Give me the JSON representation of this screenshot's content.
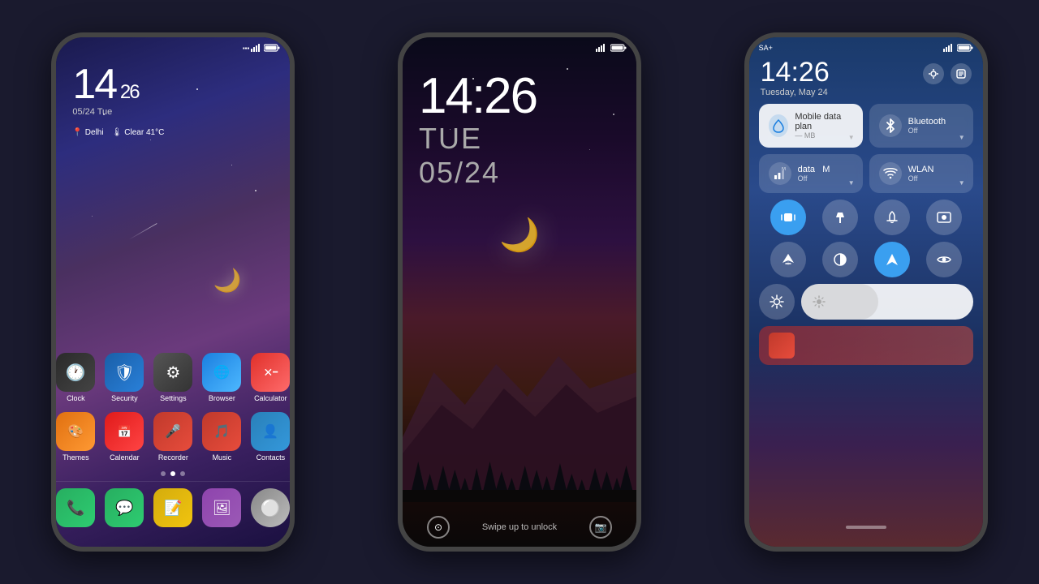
{
  "phones": [
    {
      "id": "phone1",
      "type": "home",
      "status": {
        "time": "14:26",
        "signal": true,
        "wifi": true,
        "battery": "100"
      },
      "clock": {
        "hour": "14",
        "minute": "26",
        "date": "05/24 Tue"
      },
      "weather": {
        "location": "Delhi",
        "condition": "Clear 41°C"
      },
      "apps_row1": [
        {
          "label": "Clock",
          "class": "app-clock",
          "icon": "🕐"
        },
        {
          "label": "Security",
          "class": "app-security",
          "icon": "🛡"
        },
        {
          "label": "Settings",
          "class": "app-settings",
          "icon": "⚙"
        },
        {
          "label": "Browser",
          "class": "app-browser",
          "icon": "🌐"
        },
        {
          "label": "Calculator",
          "class": "app-calculator",
          "icon": "🧮"
        }
      ],
      "apps_row2": [
        {
          "label": "Themes",
          "class": "app-themes",
          "icon": "🎨"
        },
        {
          "label": "Calendar",
          "class": "app-calendar",
          "icon": "📅"
        },
        {
          "label": "Recorder",
          "class": "app-recorder",
          "icon": "🎤"
        },
        {
          "label": "Music",
          "class": "app-music",
          "icon": "🎵"
        },
        {
          "label": "Contacts",
          "class": "app-contacts",
          "icon": "👤"
        }
      ],
      "dock": [
        {
          "label": "Phone",
          "class": "app-phone",
          "icon": "📞"
        },
        {
          "label": "Messages",
          "class": "app-messages",
          "icon": "💬"
        },
        {
          "label": "Notes",
          "class": "app-notes",
          "icon": "📝"
        },
        {
          "label": "Gallery",
          "class": "app-gallery",
          "icon": "🖼"
        },
        {
          "label": "Lens",
          "class": "app-lens",
          "icon": "⚪"
        }
      ]
    },
    {
      "id": "phone2",
      "type": "lockscreen",
      "status": {
        "signal": true,
        "battery": "100"
      },
      "clock": {
        "time": "14:26",
        "day": "TUE",
        "date": "05/24"
      },
      "swipe_text": "Swipe up to unlock"
    },
    {
      "id": "phone3",
      "type": "control_center",
      "status": {
        "carrier": "SA+",
        "signal": true,
        "battery": "100"
      },
      "header": {
        "time": "14:26",
        "date": "Tuesday, May 24"
      },
      "toggles": [
        {
          "title": "Mobile data plan",
          "sub": "— MB",
          "icon": "💧",
          "active": false,
          "highlighted": true
        },
        {
          "title": "Bluetooth",
          "sub": "Off",
          "icon": "🔵",
          "active": false,
          "highlighted": false
        },
        {
          "title": "Mobile data",
          "sub": "Off",
          "icon": "📶",
          "active": false,
          "highlighted": false
        },
        {
          "title": "WLAN",
          "sub": "Off",
          "icon": "📶",
          "active": false,
          "highlighted": false
        }
      ],
      "quick_buttons_1": [
        {
          "icon": "🔊",
          "active": true,
          "label": "vibrate"
        },
        {
          "icon": "🔦",
          "active": false,
          "label": "flashlight"
        },
        {
          "icon": "🔔",
          "active": false,
          "label": "notification"
        },
        {
          "icon": "⬚",
          "active": false,
          "label": "screenrecord"
        }
      ],
      "quick_buttons_2": [
        {
          "icon": "✈",
          "active": false,
          "label": "airplane"
        },
        {
          "icon": "◑",
          "active": false,
          "label": "reading"
        },
        {
          "icon": "➤",
          "active": true,
          "label": "location"
        },
        {
          "icon": "👁",
          "active": false,
          "label": "privacy"
        }
      ],
      "brightness": {
        "value": 45,
        "icon": "☀"
      }
    }
  ],
  "labels": {
    "bluetooth": "Bluetooth",
    "bluetooth_sub": "Off",
    "security": "Security",
    "themes": "Themes",
    "wlan": "WLAN",
    "wlan_sub": "Off",
    "mobile_data": "data",
    "mobile_data_full": "Mobile data",
    "swipe_unlock": "Swipe up to unlock"
  }
}
